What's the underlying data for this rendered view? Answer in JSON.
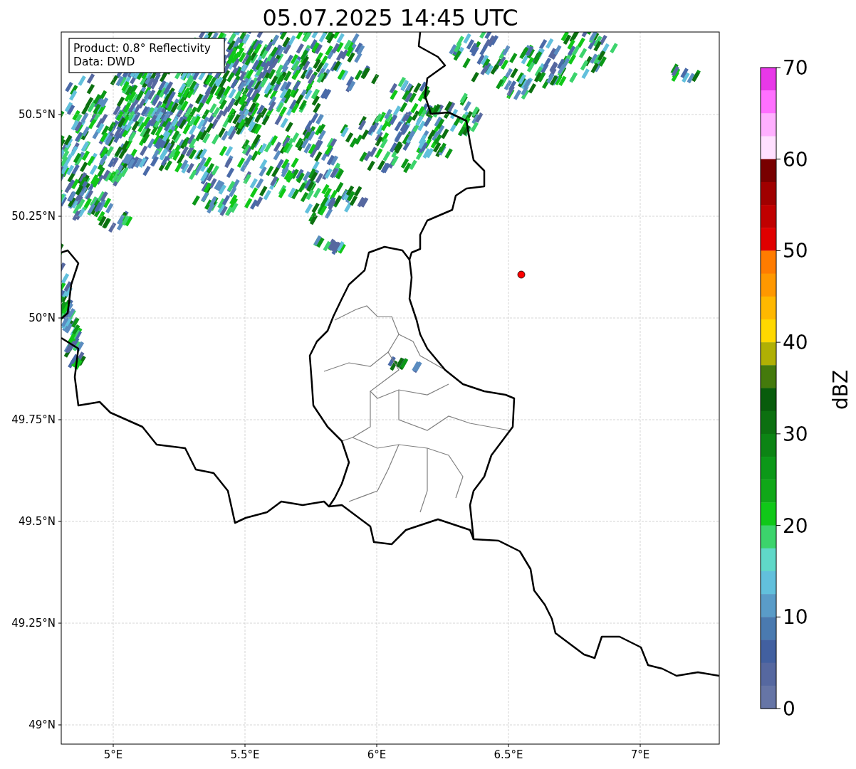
{
  "title": "05.07.2025 14:45 UTC",
  "info_box": [
    "Product: 0.8° Reflectivity",
    "Data: DWD"
  ],
  "lon_ticks": [
    "5°E",
    "5.5°E",
    "6°E",
    "6.5°E",
    "7°E"
  ],
  "lat_ticks": [
    "50.5°N",
    "50.25°N",
    "50°N",
    "49.75°N",
    "49.5°N",
    "49.25°N",
    "49°N"
  ],
  "colorbar": {
    "label": "dBZ",
    "ticks": [
      "70",
      "60",
      "50",
      "40",
      "30",
      "20",
      "10",
      "0"
    ],
    "bins": [
      {
        "color": "#e838e8"
      },
      {
        "color": "#ff70ff"
      },
      {
        "color": "#ffb0ff"
      },
      {
        "color": "#ffe0ff"
      },
      {
        "color": "#780000"
      },
      {
        "color": "#a00000"
      },
      {
        "color": "#c00000"
      },
      {
        "color": "#e00000"
      },
      {
        "color": "#ff7c00"
      },
      {
        "color": "#ff9800"
      },
      {
        "color": "#ffb800"
      },
      {
        "color": "#ffd800"
      },
      {
        "color": "#b0b004"
      },
      {
        "color": "#447a0c"
      },
      {
        "color": "#085c0c"
      },
      {
        "color": "#0c7010"
      },
      {
        "color": "#0c8414"
      },
      {
        "color": "#0c9818"
      },
      {
        "color": "#10a818"
      },
      {
        "color": "#10c818"
      },
      {
        "color": "#3cd46c"
      },
      {
        "color": "#60d8c8"
      },
      {
        "color": "#62c0dc"
      },
      {
        "color": "#5a9cc8"
      },
      {
        "color": "#4a7ab0"
      },
      {
        "color": "#4260a0"
      },
      {
        "color": "#5668a0"
      },
      {
        "color": "#6675a6"
      }
    ]
  }
}
